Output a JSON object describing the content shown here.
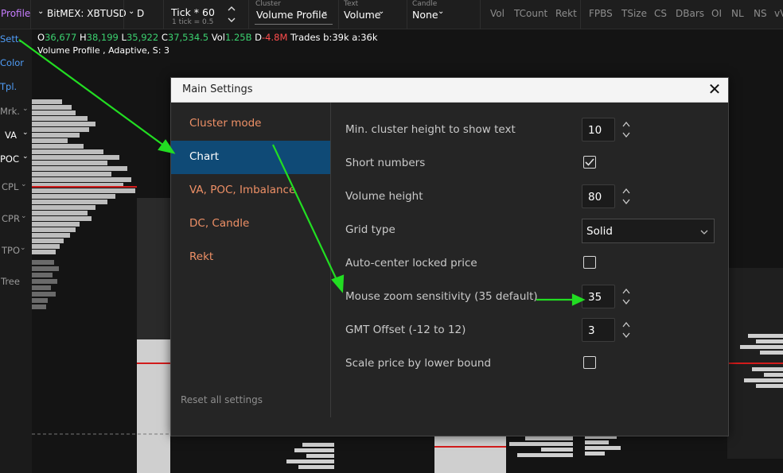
{
  "toolbar": {
    "profile_label": "Profile",
    "instrument": "BitMEX: XBTUSD",
    "timeframe": "D",
    "tick_label": "Tick * 60",
    "tick_sub": "1 tick = 0.5",
    "cluster_caption": "Cluster",
    "cluster_value": "Volume Profile",
    "text_caption": "Text",
    "text_value": "Volume",
    "candle_caption": "Candle",
    "candle_value": "None",
    "right_items": [
      "Vol",
      "TCount",
      "Rekt",
      "FPBS",
      "TSize",
      "CS",
      "DBars",
      "OI",
      "NL",
      "NS",
      "vV"
    ]
  },
  "sidebar": {
    "items": [
      "Sett.",
      "Color",
      "Tpl.",
      "Mrk.",
      "VA",
      "POC",
      "CPL",
      "CPR",
      "TPO",
      "Tree"
    ]
  },
  "ohlc": {
    "o_key": "O",
    "o_val": "36,677",
    "h_key": "H",
    "h_val": "38,199",
    "l_key": "L",
    "l_val": "35,922",
    "c_key": "C",
    "c_val": "37,534.5",
    "vol_key": "Vol",
    "vol_val": "1.25B",
    "d_key": "D",
    "d_val": "-4.8M",
    "trades": "Trades b:39k a:36k",
    "subline": "Volume Profile , Adaptive, S: 3"
  },
  "dialog": {
    "title": "Main Settings",
    "close": "✕",
    "nav": [
      "Cluster mode",
      "Chart",
      "VA, POC, Imbalance",
      "DC, Candle",
      "Rekt"
    ],
    "active_nav": "Chart",
    "reset_label": "Reset all settings",
    "settings": {
      "min_cluster_label": "Min. cluster height to show text",
      "min_cluster_value": "10",
      "short_numbers_label": "Short numbers",
      "short_numbers_checked": true,
      "volume_height_label": "Volume height",
      "volume_height_value": "80",
      "grid_type_label": "Grid type",
      "grid_type_value": "Solid",
      "auto_center_label": "Auto-center locked price",
      "auto_center_checked": false,
      "zoom_label": "Mouse zoom sensitivity (35 default)",
      "zoom_value": "35",
      "gmt_label": "GMT Offset (-12 to 12)",
      "gmt_value": "3",
      "scale_label": "Scale price by lower bound",
      "scale_checked": false
    }
  },
  "colors": {
    "accent_blue": "#4f9cf6",
    "nav_orange": "#ee9066",
    "active_nav_bg": "#0f4a76",
    "arrow_green": "#22dd22",
    "poc_red": "#d21b1b",
    "profile_purple": "#c77dff"
  }
}
